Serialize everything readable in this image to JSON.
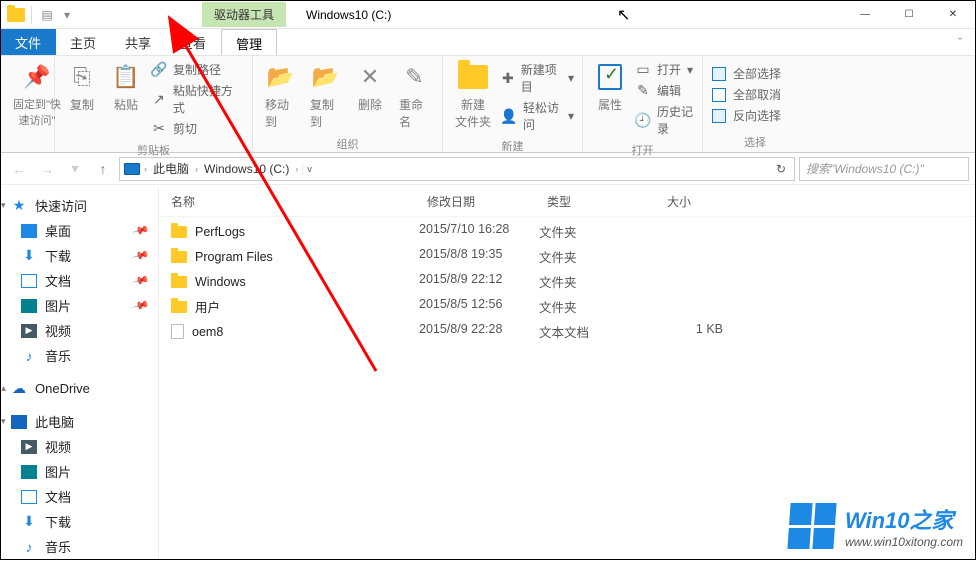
{
  "titlebar": {
    "drive_tools": "驱动器工具",
    "window_title": "Windows10 (C:)"
  },
  "tabs": {
    "file": "文件",
    "home": "主页",
    "share": "共享",
    "view": "查看",
    "manage": "管理"
  },
  "ribbon": {
    "pin_label": "固定到\"快\n速访问\"",
    "copy": "复制",
    "paste": "粘贴",
    "copy_path": "复制路径",
    "paste_shortcut": "粘贴快捷方式",
    "cut": "剪切",
    "clipboard_group": "剪贴板",
    "move_to": "移动到",
    "copy_to": "复制到",
    "delete": "删除",
    "rename": "重命名",
    "organize_group": "组织",
    "new_folder": "新建\n文件夹",
    "new_item": "新建项目",
    "easy_access": "轻松访问",
    "new_group": "新建",
    "properties": "属性",
    "open": "打开",
    "edit": "编辑",
    "history": "历史记录",
    "open_group": "打开",
    "select_all": "全部选择",
    "select_none": "全部取消",
    "invert_sel": "反向选择",
    "select_group": "选择"
  },
  "address": {
    "this_pc": "此电脑",
    "drive": "Windows10 (C:)",
    "search_placeholder": "搜索\"Windows10 (C:)\""
  },
  "sidebar": {
    "quick_access": "快速访问",
    "items_qa": [
      {
        "label": "桌面",
        "icon": "desk",
        "pin": true
      },
      {
        "label": "下载",
        "icon": "dl",
        "pin": true
      },
      {
        "label": "文档",
        "icon": "doc",
        "pin": true
      },
      {
        "label": "图片",
        "icon": "pic",
        "pin": true
      },
      {
        "label": "视频",
        "icon": "vid",
        "pin": false
      },
      {
        "label": "音乐",
        "icon": "mus",
        "pin": false
      }
    ],
    "onedrive": "OneDrive",
    "this_pc": "此电脑",
    "items_pc": [
      {
        "label": "视频",
        "icon": "vid"
      },
      {
        "label": "图片",
        "icon": "pic"
      },
      {
        "label": "文档",
        "icon": "doc"
      },
      {
        "label": "下载",
        "icon": "dl"
      },
      {
        "label": "音乐",
        "icon": "mus"
      }
    ]
  },
  "columns": {
    "name": "名称",
    "date": "修改日期",
    "type": "类型",
    "size": "大小"
  },
  "files": [
    {
      "name": "PerfLogs",
      "date": "2015/7/10 16:28",
      "type": "文件夹",
      "size": "",
      "icon": "folder"
    },
    {
      "name": "Program Files",
      "date": "2015/8/8 19:35",
      "type": "文件夹",
      "size": "",
      "icon": "folder"
    },
    {
      "name": "Windows",
      "date": "2015/8/9 22:12",
      "type": "文件夹",
      "size": "",
      "icon": "folder"
    },
    {
      "name": "用户",
      "date": "2015/8/5 12:56",
      "type": "文件夹",
      "size": "",
      "icon": "folder"
    },
    {
      "name": "oem8",
      "date": "2015/8/9 22:28",
      "type": "文本文档",
      "size": "1 KB",
      "icon": "file"
    }
  ],
  "watermark": {
    "title": "Win10之家",
    "url": "www.win10xitong.com"
  }
}
